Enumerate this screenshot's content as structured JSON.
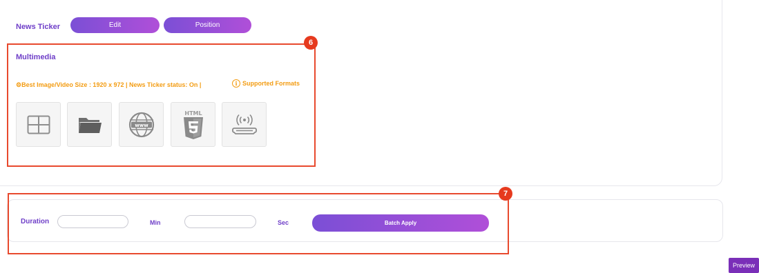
{
  "news_ticker": {
    "label": "News Ticker",
    "edit_label": "Edit",
    "position_label": "Position"
  },
  "callouts": {
    "multimedia_badge": "6",
    "duration_badge": "7",
    "color": "#e8492d"
  },
  "multimedia": {
    "title": "Multimedia",
    "info_text": "⚙Best Image/Video Size : 1920 x 972 | News Ticker status: On |",
    "formats_link": "Supported Formats",
    "tiles": [
      {
        "icon": "layout-grid-icon"
      },
      {
        "icon": "folder-icon"
      },
      {
        "icon": "globe-www-icon"
      },
      {
        "icon": "html5-icon",
        "caption": "HTML"
      },
      {
        "icon": "stream-device-icon"
      }
    ]
  },
  "duration_row": {
    "duration_label": "Duration",
    "duration_value": "",
    "min_label": "Min",
    "min_value": "",
    "sec_label": "Sec",
    "batch_apply_label": "Batch Apply"
  },
  "preview_label": "Preview",
  "colors": {
    "accent_purple": "#6f3fc8",
    "gradient_start": "#7b4fd6",
    "gradient_end": "#b04fd8",
    "warning_orange": "#f39c12",
    "preview_bg": "#7a2fb8"
  }
}
